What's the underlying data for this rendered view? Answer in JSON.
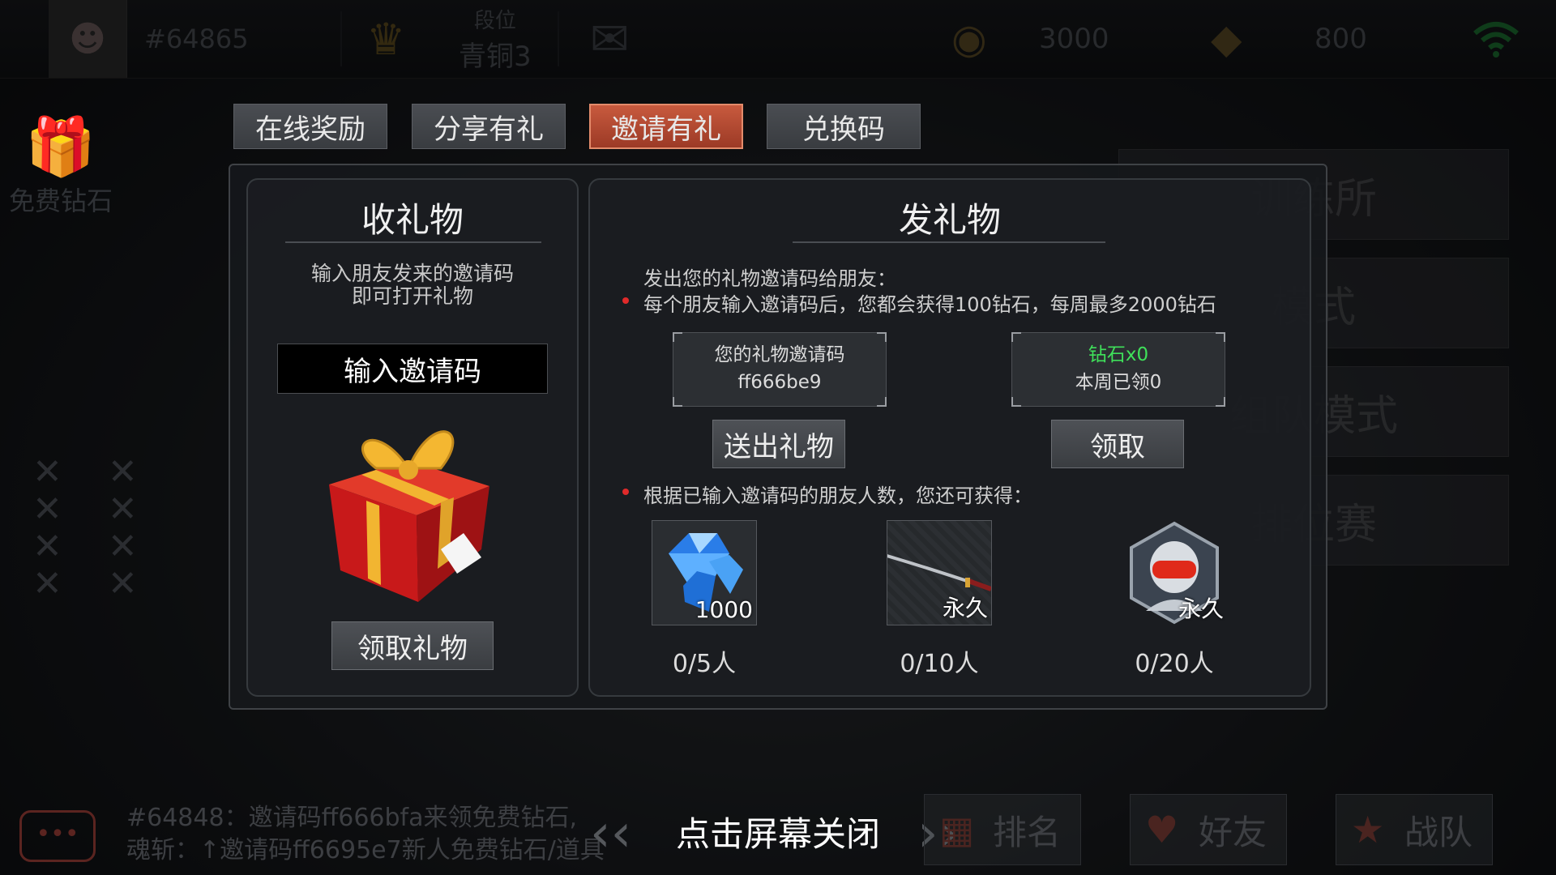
{
  "topbar": {
    "player_id": "#64865",
    "rank_label": "段位",
    "rank_value": "青铜3",
    "coins": "3000",
    "gems": "800"
  },
  "side": {
    "free_gem_label": "免费钻石"
  },
  "right_menu": [
    "训练所",
    "模式",
    "组队模式",
    "排位赛"
  ],
  "tabs": [
    {
      "label": "在线奖励",
      "active": false
    },
    {
      "label": "分享有礼",
      "active": false
    },
    {
      "label": "邀请有礼",
      "active": true
    },
    {
      "label": "兑换码",
      "active": false
    }
  ],
  "receive": {
    "title": "收礼物",
    "desc_line1": "输入朋友发来的邀请码",
    "desc_line2": "即可打开礼物",
    "input_placeholder": "输入邀请码",
    "claim_button": "领取礼物"
  },
  "send": {
    "title": "发礼物",
    "intro": "发出您的礼物邀请码给朋友：",
    "rule": "每个朋友输入邀请码后，您都会获得100钻石，每周最多2000钻石",
    "code_label": "您的礼物邀请码",
    "code_value": "ff666be9",
    "gem_reward": "钻石x0",
    "week_claimed": "本周已领0",
    "send_button": "送出礼物",
    "claim_button": "领取",
    "milestone_intro": "根据已输入邀请码的朋友人数，您还可获得：",
    "rewards": [
      {
        "label": "1000",
        "progress": "0/5人",
        "icon": "diamond-pile-icon"
      },
      {
        "label": "永久",
        "progress": "0/10人",
        "icon": "katana-icon"
      },
      {
        "label": "永久",
        "progress": "0/20人",
        "icon": "helmet-avatar-icon"
      }
    ]
  },
  "bottom": {
    "chat_line1": "#64848：邀请码ff666bfa来领免费钻石,",
    "chat_line2": "魂斩：↑邀请码ff6695e7新人免费钻石/道具",
    "close_hint": "点击屏幕关闭",
    "ranking": "排名",
    "friends": "好友",
    "team": "战队"
  }
}
